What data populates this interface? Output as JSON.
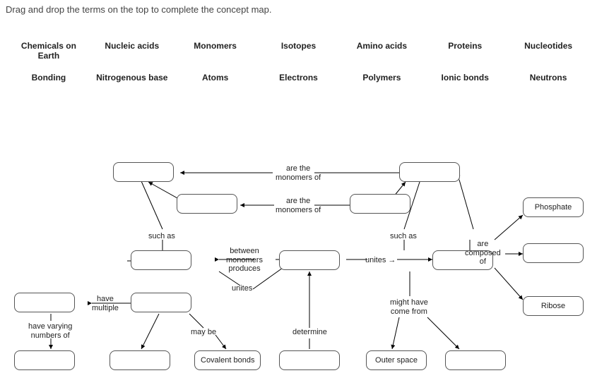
{
  "instruction": "Drag and drop the terms on the top to complete the concept map.",
  "bank": {
    "row1": [
      "Chemicals on Earth",
      "Nucleic acids",
      "Monomers",
      "Isotopes",
      "Amino acids",
      "Proteins",
      "Nucleotides"
    ],
    "row2": [
      "Bonding",
      "Nitrogenous base",
      "Atoms",
      "Electrons",
      "Polymers",
      "Ionic bonds",
      "Neutrons"
    ]
  },
  "labels": {
    "monomers_of_1": "are the\nmonomers of",
    "monomers_of_2": "are the\nmonomers of",
    "such_as_left": "such as",
    "such_as_right": "such as",
    "between": "between\nmonomers\nproduces",
    "unites_left": "unites",
    "unites_right": "unites",
    "have_multiple": "have\nmultiple",
    "have_varying": "have varying\nnumbers of",
    "may_be": "may be",
    "determine": "determine",
    "might_from": "might have\ncome from",
    "composed": "are\ncomposed\nof"
  },
  "filled": {
    "covalent": "Covalent bonds",
    "outer": "Outer space",
    "phosphate": "Phosphate",
    "ribose": "Ribose"
  }
}
